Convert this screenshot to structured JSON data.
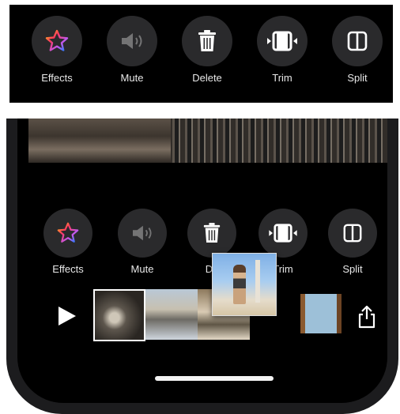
{
  "top_toolbar": {
    "effects_label": "Effects",
    "mute_label": "Mute",
    "delete_label": "Delete",
    "trim_label": "Trim",
    "split_label": "Split"
  },
  "phone_toolbar": {
    "effects_label": "Effects",
    "mute_label": "Mute",
    "delete_label": "De",
    "trim_label": "Trim",
    "split_label": "Split"
  },
  "icons": {
    "effects": "star-icon",
    "mute": "speaker-icon",
    "delete": "trash-icon",
    "trim": "trim-icon",
    "split": "split-icon",
    "play": "play-icon",
    "share": "share-icon"
  },
  "colors": {
    "toolbar_bg": "#000000",
    "button_bg": "#2a2a2c",
    "label": "#e8e8e8",
    "home_indicator": "#f2f2f2"
  }
}
